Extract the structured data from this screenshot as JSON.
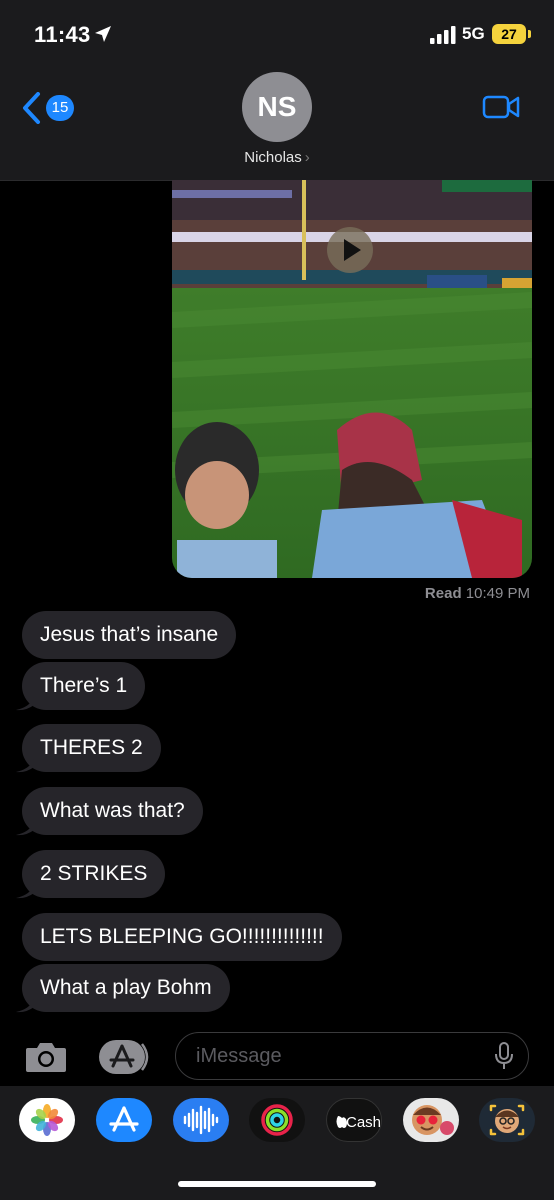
{
  "status_bar": {
    "time": "11:43",
    "network": "5G",
    "battery": "27"
  },
  "header": {
    "back_badge": "15",
    "avatar_initials": "NS",
    "contact_name": "Nicholas",
    "contact_chevron": "›"
  },
  "media_message": {
    "read_label": "Read",
    "read_time": "10:49 PM"
  },
  "messages": [
    "Jesus that’s insane",
    "There’s 1",
    "THERES 2",
    "What was that?",
    "2 STRIKES",
    "LETS BLEEPING GO!!!!!!!!!!!!!!",
    "What a play Bohm"
  ],
  "input": {
    "placeholder": "iMessage"
  },
  "drawer": {
    "apps": [
      "photos-icon",
      "app-store-icon",
      "audio-message-icon",
      "fitness-icon",
      "apple-cash-icon",
      "memoji-stickers-icon",
      "memoji-icon"
    ],
    "cash_label": "Cash"
  },
  "colors": {
    "accent": "#1e88ff",
    "bubble": "#26252a",
    "header_bg": "#1b1b1d",
    "battery": "#f5d33d"
  }
}
